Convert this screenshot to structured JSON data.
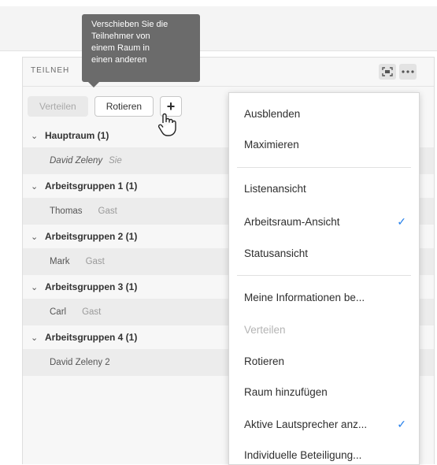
{
  "tooltip": {
    "lines": [
      "Verschieben Sie die",
      "Teilnehmer von",
      "einem Raum in",
      "einen anderen"
    ]
  },
  "pod": {
    "title": "TEILNEH",
    "fullscreen_icon": "fullscreen-icon",
    "more_icon": "more-icon"
  },
  "toolbar": {
    "distribute_label": "Verteilen",
    "rotate_label": "Rotieren",
    "add_label": "+"
  },
  "groups": [
    {
      "label": "Hauptraum (1)",
      "members": [
        {
          "name": "David Zeleny",
          "role": "Sie"
        }
      ]
    },
    {
      "label": "Arbeitsgruppen 1 (1)",
      "members": [
        {
          "name": "Thomas",
          "role": "Gast"
        }
      ]
    },
    {
      "label": "Arbeitsgruppen 2 (1)",
      "members": [
        {
          "name": "Mark",
          "role": "Gast"
        }
      ]
    },
    {
      "label": "Arbeitsgruppen 3 (1)",
      "members": [
        {
          "name": "Carl",
          "role": "Gast"
        }
      ]
    },
    {
      "label": "Arbeitsgruppen 4 (1)",
      "members": [
        {
          "name": "David Zeleny 2",
          "role": ""
        }
      ]
    }
  ],
  "menu": {
    "items": [
      {
        "label": "Ausblenden"
      },
      {
        "label": "Maximieren"
      },
      {
        "label": "Listenansicht"
      },
      {
        "label": "Arbeitsraum-Ansicht",
        "checked": true
      },
      {
        "label": "Statusansicht"
      },
      {
        "label": "Meine Informationen be..."
      },
      {
        "label": "Verteilen",
        "disabled": true
      },
      {
        "label": "Rotieren"
      },
      {
        "label": "Raum hinzufügen"
      },
      {
        "label": "Aktive Lautsprecher anz...",
        "checked": true
      },
      {
        "label": "Individuelle Beteiligung..."
      }
    ],
    "check_glyph": "✓"
  },
  "colors": {
    "accent": "#2680eb",
    "tooltip_bg": "#6b6b6b",
    "panel_bg": "#f7f7f7",
    "member_row_bg": "#ececec"
  }
}
